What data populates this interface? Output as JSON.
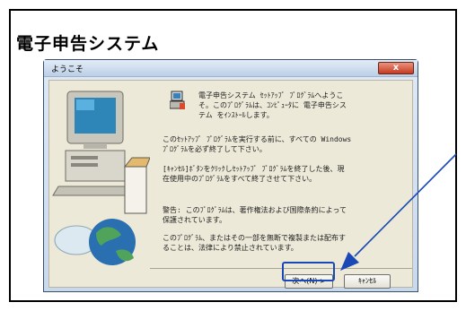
{
  "heading": "電子申告システム",
  "dialog": {
    "title": "ようこそ",
    "close_label": "x",
    "message_lines": [
      [
        "電子申告システム ｾｯﾄｱｯﾌﾟ ﾌﾟﾛｸﾞﾗﾑへようこ",
        "そ。このﾌﾟﾛｸﾞﾗﾑは、ｺﾝﾋﾟｭｰﾀに 電子申告シス",
        "テム をｲﾝｽﾄｰﾙします。"
      ],
      [
        "このｾｯﾄｱｯﾌﾟ ﾌﾟﾛｸﾞﾗﾑを実行する前に、すべての Windows",
        "ﾌﾟﾛｸﾞﾗﾑを必ず終了して下さい。"
      ],
      [
        "[ｷｬﾝｾﾙ]ﾎﾞﾀﾝをｸﾘｯｸしｾｯﾄｱｯﾌﾟ ﾌﾟﾛｸﾞﾗﾑを終了した後、現",
        "在使用中のﾌﾟﾛｸﾞﾗﾑをすべて終了させて下さい。"
      ],
      [
        "警告: このﾌﾟﾛｸﾞﾗﾑは、著作権法および国際条約によって",
        "保護されています。"
      ],
      [
        "このﾌﾟﾛｸﾞﾗﾑ、またはその一部を無断で複製または配布す",
        "ることは、法律により禁止されています。"
      ]
    ],
    "next_label": "次へ(N) >",
    "cancel_label": "ｷｬﾝｾﾙ"
  },
  "colors": {
    "annotation": "#1a49b6",
    "close_button": "#c63a1f",
    "dialog_face": "#ece9d8"
  },
  "icons": [
    "setup-computer-illustration",
    "globe-cd-icon",
    "installer-icon",
    "annotation-arrow"
  ]
}
